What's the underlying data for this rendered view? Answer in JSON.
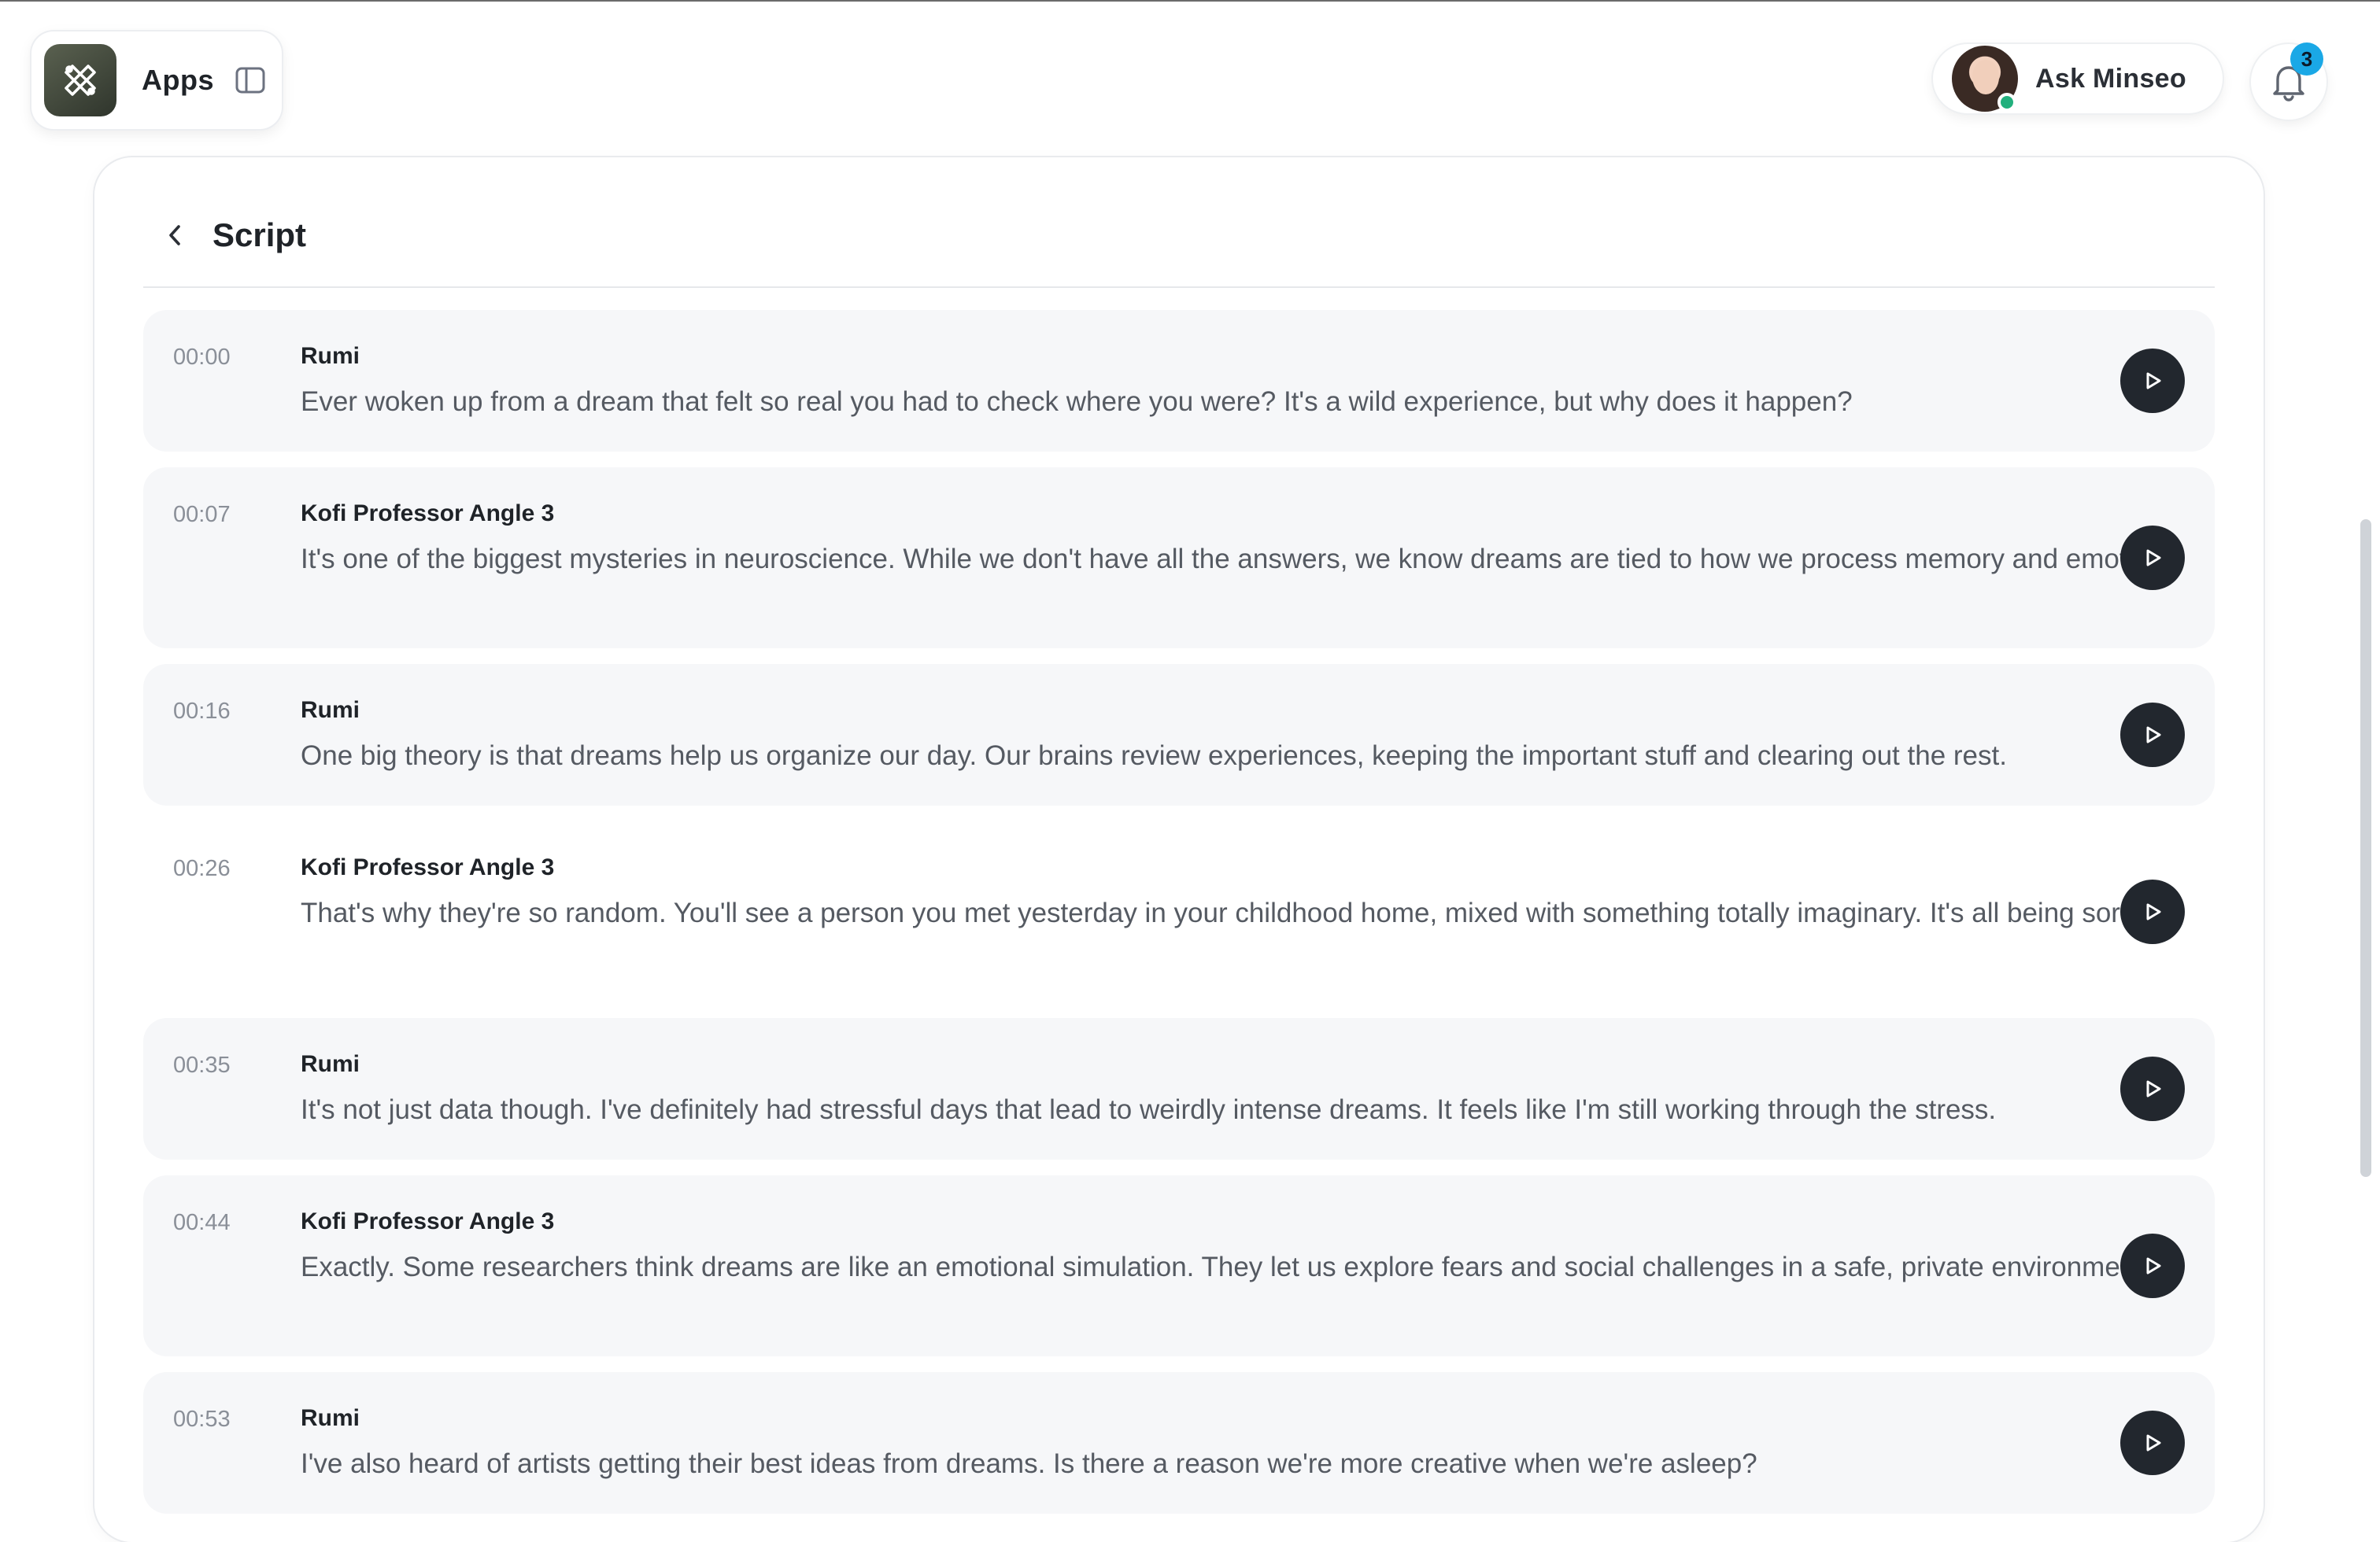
{
  "header": {
    "apps_label": "Apps",
    "ask_label": "Ask Minseo",
    "notification_count": "3"
  },
  "panel": {
    "title": "Script"
  },
  "script": {
    "rows": [
      {
        "time": "00:00",
        "speaker": "Rumi",
        "text": "Ever woken up from a dream that felt so real you had to check where you were? It's a wild experience, but why does it happen?"
      },
      {
        "time": "00:07",
        "speaker": "Kofi Professor Angle 3",
        "text": "It's one of the biggest mysteries in neuroscience. While we don't have all the answers, we know dreams are tied to how we process memory and emotions."
      },
      {
        "time": "00:16",
        "speaker": "Rumi",
        "text": "One big theory is that dreams help us organize our day. Our brains review experiences, keeping the important stuff and clearing out the rest."
      },
      {
        "time": "00:26",
        "speaker": "Kofi Professor Angle 3",
        "text": "That's why they're so random. You'll see a person you met yesterday in your childhood home, mixed with something totally imaginary. It's all being sorted."
      },
      {
        "time": "00:35",
        "speaker": "Rumi",
        "text": "It's not just data though. I've definitely had stressful days that lead to weirdly intense dreams. It feels like I'm still working through the stress."
      },
      {
        "time": "00:44",
        "speaker": "Kofi Professor Angle 3",
        "text": "Exactly. Some researchers think dreams are like an emotional simulation. They let us explore fears and social challenges in a safe, private environment."
      },
      {
        "time": "00:53",
        "speaker": "Rumi",
        "text": "I've also heard of artists getting their best ideas from dreams. Is there a reason we're more creative when we're asleep?"
      }
    ]
  },
  "colors": {
    "row_bg": "#f6f7f9",
    "play_bg": "#22272e",
    "badge": "#1aa8e6",
    "status_online": "#22b07d"
  }
}
